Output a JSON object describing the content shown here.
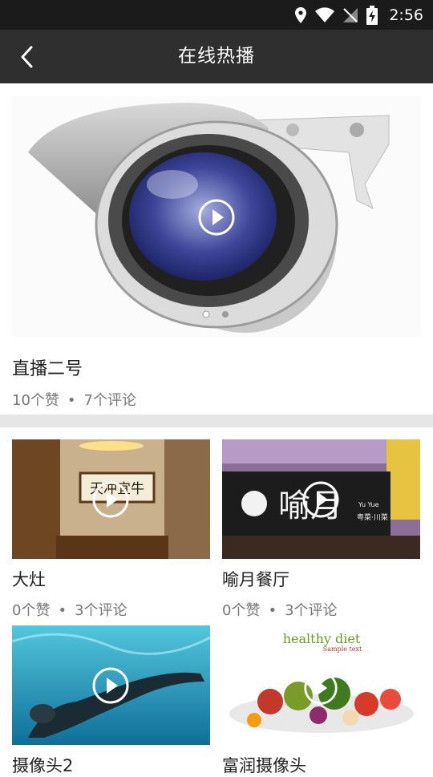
{
  "status_bar": {
    "time": "2:56"
  },
  "app_bar": {
    "title": "在线热播"
  },
  "featured": {
    "title": "直播二号",
    "likes": "10个赞",
    "separator": "•",
    "comments": "7个评论",
    "carousel_index": 1,
    "carousel_count": 2
  },
  "videos": [
    {
      "title": "大灶",
      "likes": "0个赞",
      "separator": "•",
      "comments": "3个评论",
      "thumb_text": "天冲宜牛"
    },
    {
      "title": "喻月餐厅",
      "likes": "0个赞",
      "separator": "•",
      "comments": "3个评论",
      "thumb_text": "喻月",
      "thumb_small": "Yu Yue",
      "thumb_sub": "粤菜·川菜"
    },
    {
      "title": "摄像头2",
      "likes": "",
      "separator": "",
      "comments": ""
    },
    {
      "title": "富润摄像头",
      "likes": "",
      "separator": "",
      "comments": "",
      "thumb_text": "healthy diet",
      "thumb_sub": "Sample text"
    }
  ]
}
